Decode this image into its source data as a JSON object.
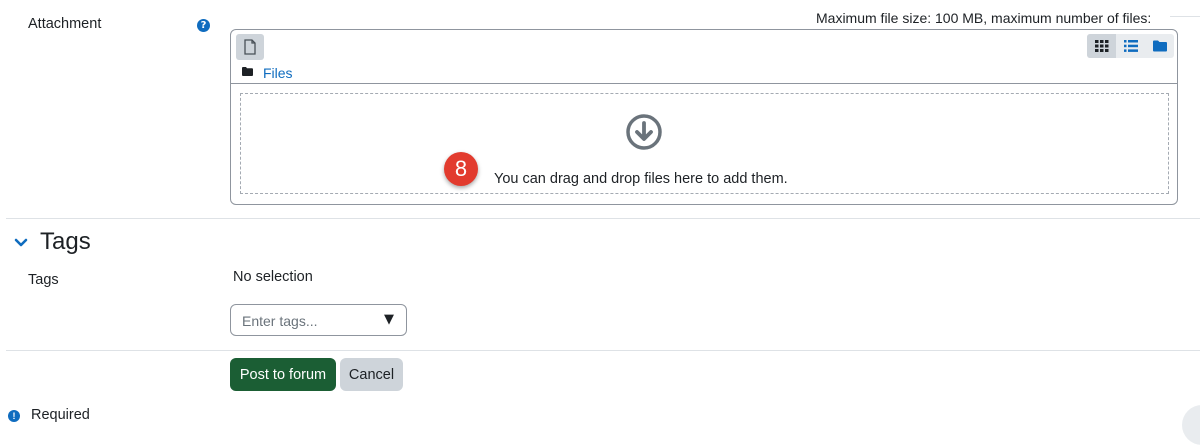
{
  "attachment": {
    "label": "Attachment",
    "help_icon": "question-circle-icon",
    "max_info": "Maximum file size: 100 MB, maximum number of files:",
    "breadcrumb_folder_icon": "folder-icon",
    "breadcrumb_label": "Files",
    "add_file_icon": "file-icon",
    "view_modes": [
      "grid-view-icon",
      "list-view-icon",
      "folder-view-icon"
    ],
    "dropzone_icon": "arrow-circle-down-icon",
    "dropzone_text": "You can drag and drop files here to add them."
  },
  "step_badge": "8",
  "tags_section": {
    "title": "Tags",
    "toggle_icon": "chevron-down-icon",
    "field_label": "Tags",
    "selection_text": "No selection",
    "input_placeholder": "Enter tags...",
    "dropdown_arrow": "▼"
  },
  "actions": {
    "post_label": "Post to forum",
    "cancel_label": "Cancel"
  },
  "footer": {
    "required_label": "Required",
    "required_icon": "exclamation-circle-icon"
  },
  "colors": {
    "primary_button": "#1b5e34",
    "secondary_button": "#ced4da",
    "link": "#0f6cbf",
    "badge": "#e23b2e"
  }
}
